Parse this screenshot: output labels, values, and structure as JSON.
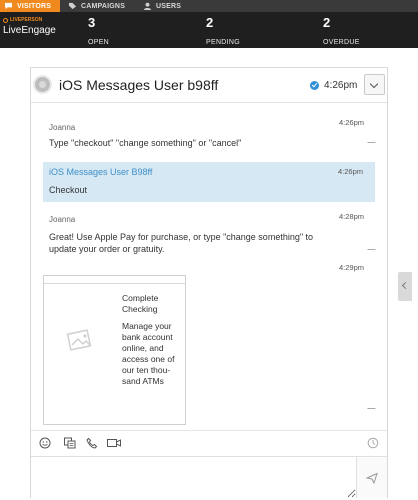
{
  "topnav": {
    "tabs": [
      {
        "label": "VISITORS",
        "icon": "chat-bubble-icon"
      },
      {
        "label": "CAMPAIGNS",
        "icon": "tag-icon"
      },
      {
        "label": "USERS",
        "icon": "user-icon"
      }
    ]
  },
  "brand": {
    "small": "LIVEPERSON",
    "big": "LiveEngage"
  },
  "stats": [
    {
      "value": "3",
      "label": "OPEN"
    },
    {
      "value": "2",
      "label": "PENDING"
    },
    {
      "value": "2",
      "label": "OVERDUE"
    }
  ],
  "conversation": {
    "visitor_name": "iOS Messages User b98ff",
    "time": "4:26pm",
    "messages": [
      {
        "sender": "Joanna",
        "time": "4:26pm",
        "text": "Type \"checkout\" \"change something\" or \"cancel\""
      },
      {
        "sender": "iOS Messages User B98ff",
        "time": "4:26pm",
        "text": "Checkout"
      },
      {
        "sender": "Joanna",
        "time": "4:28pm",
        "text_line1": "Great! Use Apple Pay for purchase, or type \"change something\" to",
        "text_line2": "update your order or gratuity."
      },
      {
        "sender": "",
        "time": "4:29pm"
      }
    ],
    "rich_card": {
      "title_lines": [
        "Complete",
        "Checking"
      ],
      "body_lines": [
        "Manage your",
        "bank account",
        "online, and",
        "access one of",
        "our ten thou-",
        "sand ATMs"
      ]
    }
  },
  "composer": {
    "placeholder": ""
  },
  "colors": {
    "accent": "#f08a1e",
    "highlight": "#d6e8f3",
    "link": "#3e8fc9",
    "check": "#2f8fd6"
  }
}
